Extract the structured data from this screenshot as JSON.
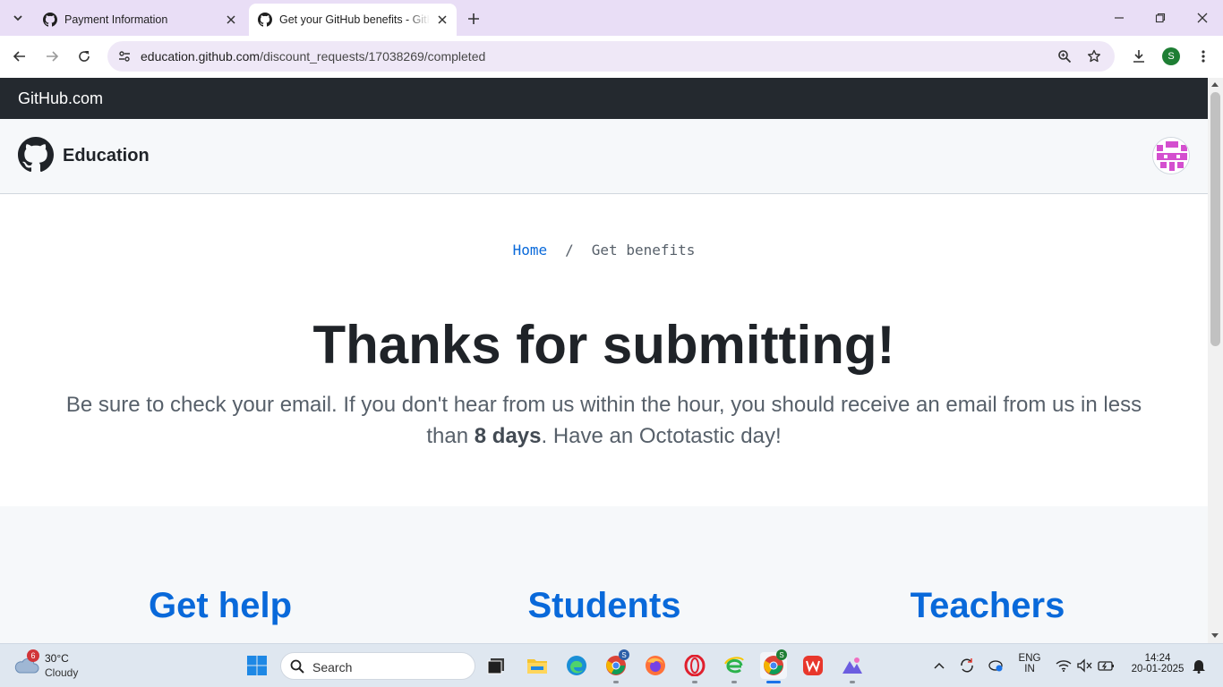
{
  "browser": {
    "tabs": [
      {
        "title": "Payment Information",
        "active": false
      },
      {
        "title": "Get your GitHub benefits - GitHub Education",
        "active": true
      }
    ],
    "url_host": "education.github.com",
    "url_path": "/discount_requests/17038269/completed",
    "profile_initial": "S"
  },
  "page": {
    "topbar_title": "GitHub.com",
    "header_title": "Education",
    "breadcrumb": {
      "home": "Home",
      "separator": "/",
      "current": "Get benefits"
    },
    "headline": "Thanks for submitting!",
    "lede_before": "Be sure to check your email. If you don't hear from us within the hour, you should receive an email from us in less than ",
    "lede_bold": "8 days",
    "lede_after": ". Have an Octotastic day!",
    "columns": [
      "Get help",
      "Students",
      "Teachers"
    ]
  },
  "taskbar": {
    "weather_temp": "30°C",
    "weather_condition": "Cloudy",
    "weather_badge": "6",
    "search_label": "Search",
    "language_line1": "ENG",
    "language_line2": "IN",
    "time": "14:24",
    "date": "20-01-2025"
  },
  "colors": {
    "accent": "#0969da",
    "topbar": "#24292f",
    "tabstrip": "#e9def6"
  }
}
